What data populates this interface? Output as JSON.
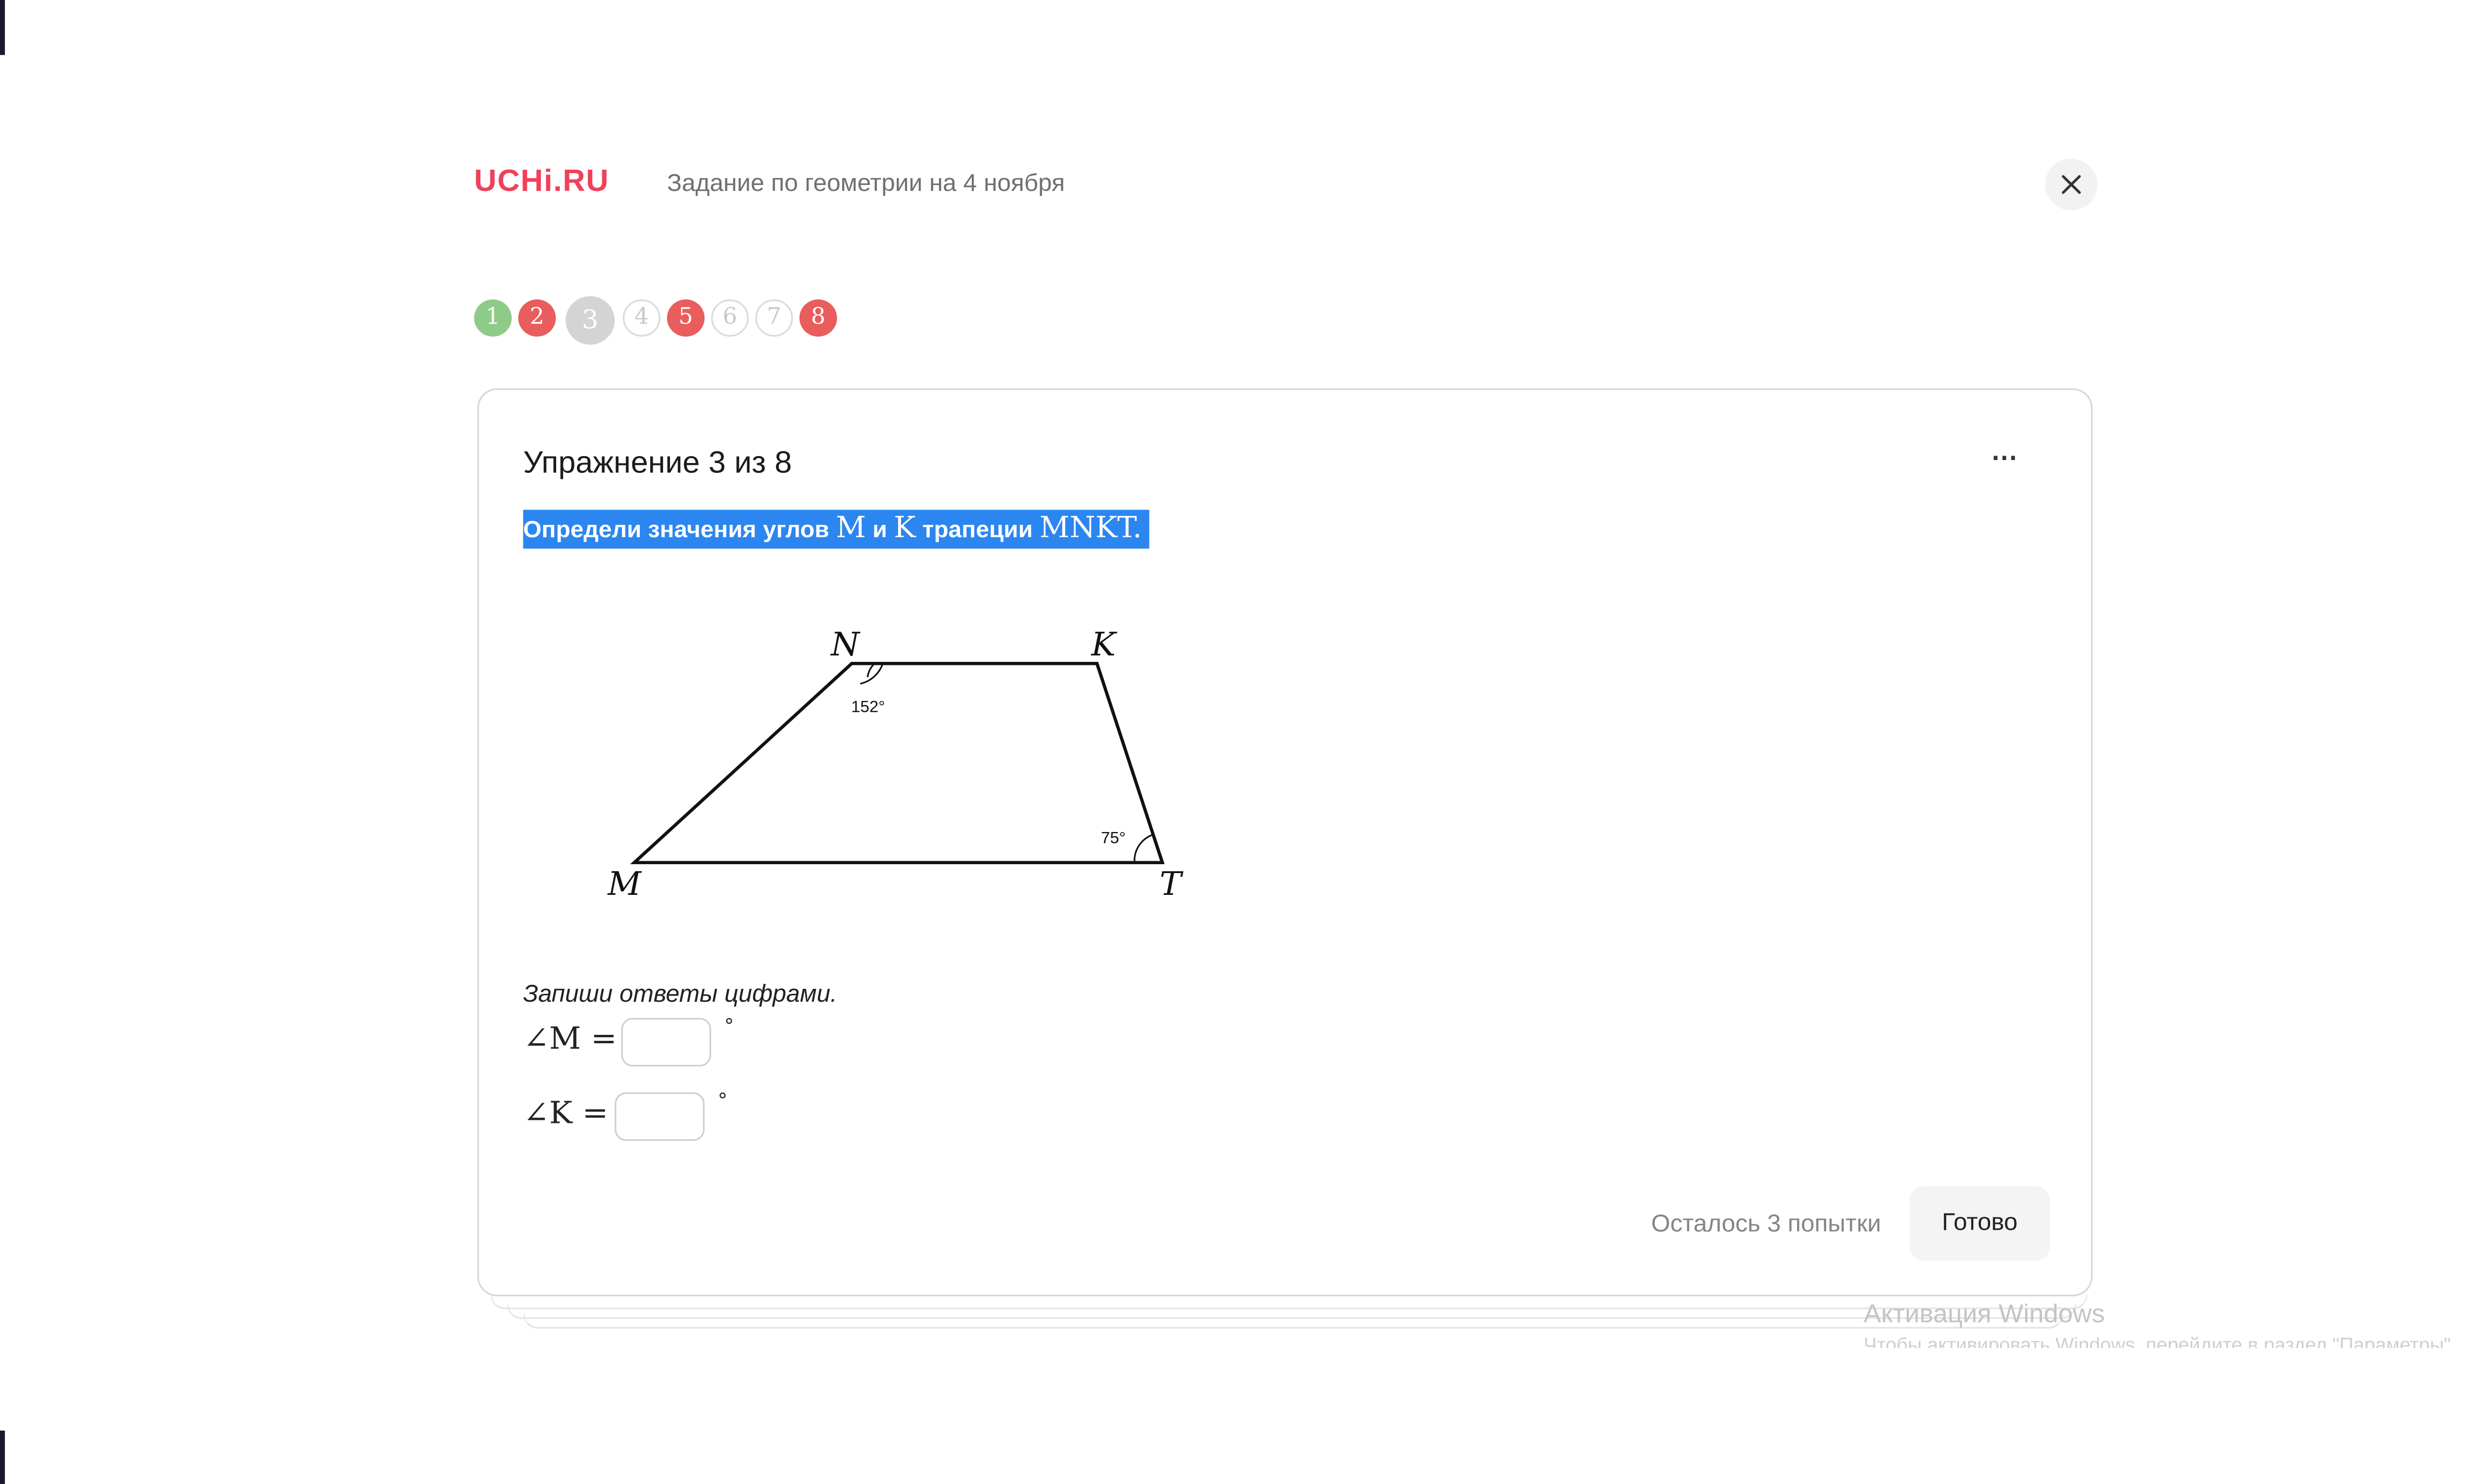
{
  "header": {
    "logo": "UCHi.RU",
    "title": "Задание по геометрии на 4 ноября"
  },
  "steps": [
    {
      "label": "1",
      "state": "correct"
    },
    {
      "label": "2",
      "state": "wrong"
    },
    {
      "label": "3",
      "state": "current"
    },
    {
      "label": "4",
      "state": "empty"
    },
    {
      "label": "5",
      "state": "wrong"
    },
    {
      "label": "6",
      "state": "empty"
    },
    {
      "label": "7",
      "state": "empty"
    },
    {
      "label": "8",
      "state": "wrong"
    }
  ],
  "card": {
    "title": "Упражнение 3 из 8",
    "more_icon": "⋯",
    "question": {
      "t1": "Определи значения углов ",
      "v1": "M",
      "t2": " и ",
      "v2": "K",
      "t3": " трапеции ",
      "v3": "MNKT",
      "t4": "."
    },
    "figure": {
      "vertices": [
        "N",
        "K",
        "M",
        "T"
      ],
      "angle_n": "152°",
      "angle_t": "75°"
    },
    "instruction": "Запиши ответы цифрами.",
    "answers": [
      {
        "label": "∠M =",
        "value": "",
        "unit": "°"
      },
      {
        "label": "∠K =",
        "value": "",
        "unit": "°"
      }
    ],
    "attempts_text": "Осталось 3 попытки",
    "submit_label": "Готово"
  },
  "watermark": {
    "title": "Активация Windows",
    "subtitle": "Чтобы активировать Windows, перейдите в раздел \"Параметры\"."
  },
  "colors": {
    "logo": "#f0415a",
    "step_correct": "#8fcb88",
    "step_wrong": "#ea5d5d",
    "step_current": "#d4d4d4",
    "selection": "#2b86f0"
  }
}
